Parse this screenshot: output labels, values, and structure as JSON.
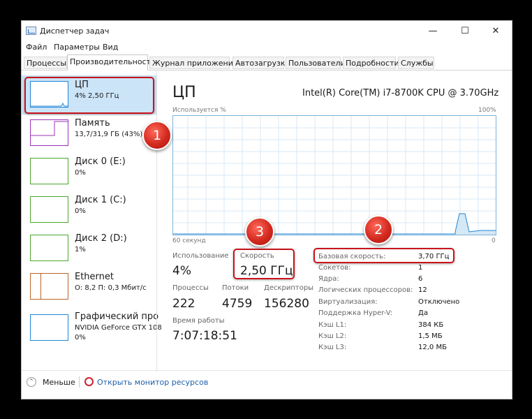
{
  "window": {
    "title": "Диспетчер задач",
    "minimize": "—",
    "maximize": "☐",
    "close": "✕"
  },
  "menu": [
    "Файл",
    "Параметры",
    "Вид"
  ],
  "tabs": [
    "Процессы",
    "Производительность",
    "Журнал приложений",
    "Автозагрузка",
    "Пользователи",
    "Подробности",
    "Службы"
  ],
  "active_tab": 1,
  "sidebar": [
    {
      "name": "ЦП",
      "sub": "4% 2,50 ГГц",
      "color": "#1d86d8"
    },
    {
      "name": "Память",
      "sub": "13,7/31,9 ГБ (43%)",
      "color": "#9b33b7"
    },
    {
      "name": "Диск 0 (E:)",
      "sub": "0%",
      "color": "#4aa72b"
    },
    {
      "name": "Диск 1 (C:)",
      "sub": "0%",
      "color": "#4aa72b"
    },
    {
      "name": "Диск 2 (D:)",
      "sub": "1%",
      "color": "#4aa72b"
    },
    {
      "name": "Ethernet",
      "sub": "О: 8,2 П: 0,3 Мбит/с",
      "color": "#b9652b"
    },
    {
      "name": "Графический про",
      "sub": "NVIDIA GeForce GTX 108",
      "sub2": "0%",
      "color": "#1d86d8"
    }
  ],
  "main": {
    "title": "ЦП",
    "model": "Intel(R) Core(TM) i7-8700K CPU @ 3.70GHz",
    "graph_label": "Используется %",
    "graph_max": "100%",
    "graph_time": "60 секунд",
    "graph_min": "0",
    "stats": {
      "usage_label": "Использование",
      "usage": "4%",
      "speed_label": "Скорость",
      "speed": "2,50 ГГц",
      "processes_label": "Процессы",
      "processes": "222",
      "threads_label": "Потоки",
      "threads": "4759",
      "handles_label": "Дескрипторы",
      "handles": "156280",
      "uptime_label": "Время работы",
      "uptime": "7:07:18:51"
    },
    "details": [
      {
        "key": "Базовая скорость:",
        "value": "3,70 ГГц"
      },
      {
        "key": "Сокетов:",
        "value": "1"
      },
      {
        "key": "Ядра:",
        "value": "6"
      },
      {
        "key": "Логических процессоров:",
        "value": "12"
      },
      {
        "key": "Виртуализация:",
        "value": "Отключено"
      },
      {
        "key": "Поддержка Hyper-V:",
        "value": "Да"
      },
      {
        "key": "Кэш L1:",
        "value": "384 КБ"
      },
      {
        "key": "Кэш L2:",
        "value": "1,5 МБ"
      },
      {
        "key": "Кэш L3:",
        "value": "12,0 МБ"
      }
    ]
  },
  "footer": {
    "less": "Меньше",
    "monitor": "Открыть монитор ресурсов"
  },
  "badges": [
    "1",
    "2",
    "3"
  ],
  "colors": {
    "accent": "#1d86d8",
    "highlight": "#c9131b",
    "link": "#1f5eab"
  }
}
